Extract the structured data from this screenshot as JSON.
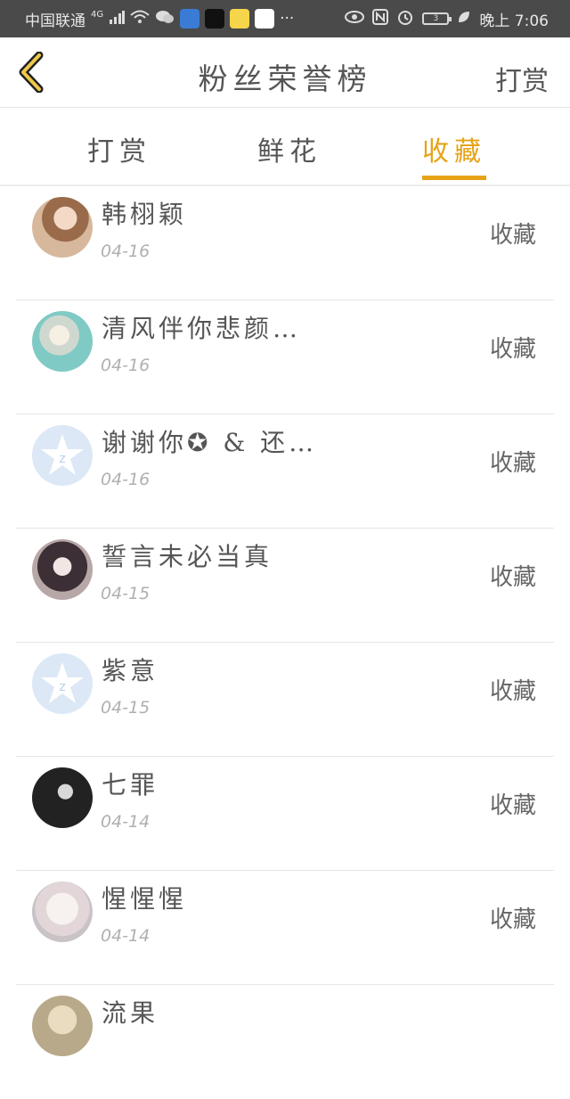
{
  "status_bar": {
    "carrier": "中国联通",
    "network": "4G",
    "time": "晚上 7:06",
    "battery": "3"
  },
  "header": {
    "title": "粉丝荣誉榜",
    "action": "打赏",
    "back_icon": "chevron-left-icon"
  },
  "tabs": [
    {
      "label": "打赏",
      "active": false
    },
    {
      "label": "鲜花",
      "active": false
    },
    {
      "label": "收藏",
      "active": true
    }
  ],
  "colors": {
    "accent": "#e6a316",
    "text": "#555555",
    "date": "#b0b0b0",
    "status_bar": "#4a4a4a"
  },
  "fans": [
    {
      "name": "韩栩颖",
      "date": "04-16",
      "action": "收藏",
      "avatar": "photo-avatar"
    },
    {
      "name": "清风伴你悲颜…",
      "date": "04-16",
      "action": "收藏",
      "avatar": "anime-avatar"
    },
    {
      "name": "谢谢你✪ & 还…",
      "date": "04-16",
      "action": "收藏",
      "avatar": "default-star-avatar"
    },
    {
      "name": "誓言未必当真",
      "date": "04-15",
      "action": "收藏",
      "avatar": "anime-avatar"
    },
    {
      "name": "紫意",
      "date": "04-15",
      "action": "收藏",
      "avatar": "default-star-avatar"
    },
    {
      "name": "七罪",
      "date": "04-14",
      "action": "收藏",
      "avatar": "dark-avatar"
    },
    {
      "name": "惺惺惺",
      "date": "04-14",
      "action": "收藏",
      "avatar": "anime-avatar"
    },
    {
      "name": "流果",
      "date": "",
      "action": "",
      "avatar": "photo-avatar"
    }
  ]
}
